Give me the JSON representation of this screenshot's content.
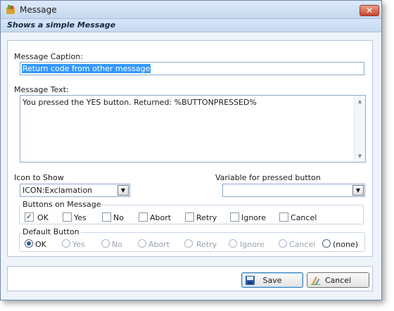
{
  "window": {
    "title": "Message",
    "subtitle": "Shows a simple Message"
  },
  "caption": {
    "label": "Message Caption:",
    "value": "Return code from other message"
  },
  "text": {
    "label": "Message Text:",
    "value": "You pressed the YES button.  Returned: %BUTTONPRESSED%"
  },
  "icon_select": {
    "label": "Icon to Show",
    "value": "ICON:Exclamation"
  },
  "variable_select": {
    "label": "Variable for pressed button",
    "value": ""
  },
  "buttons_group": {
    "title": "Buttons on Message",
    "items": [
      {
        "label": "OK",
        "checked": true
      },
      {
        "label": "Yes",
        "checked": false
      },
      {
        "label": "No",
        "checked": false
      },
      {
        "label": "Abort",
        "checked": false
      },
      {
        "label": "Retry",
        "checked": false
      },
      {
        "label": "Ignore",
        "checked": false
      },
      {
        "label": "Cancel",
        "checked": false
      }
    ]
  },
  "default_group": {
    "title": "Default Button",
    "items": [
      {
        "label": "OK",
        "selected": true,
        "enabled": true
      },
      {
        "label": "Yes",
        "selected": false,
        "enabled": false
      },
      {
        "label": "No",
        "selected": false,
        "enabled": false
      },
      {
        "label": "Abort",
        "selected": false,
        "enabled": false
      },
      {
        "label": "Retry",
        "selected": false,
        "enabled": false
      },
      {
        "label": "Ignore",
        "selected": false,
        "enabled": false
      },
      {
        "label": "Cancel",
        "selected": false,
        "enabled": false
      },
      {
        "label": "(none)",
        "selected": false,
        "enabled": true
      }
    ]
  },
  "footer": {
    "save_label": "Save",
    "cancel_label": "Cancel"
  },
  "colors": {
    "accent": "#3399ff",
    "titlebar": "#c6d8ef",
    "close": "#c8452c"
  }
}
